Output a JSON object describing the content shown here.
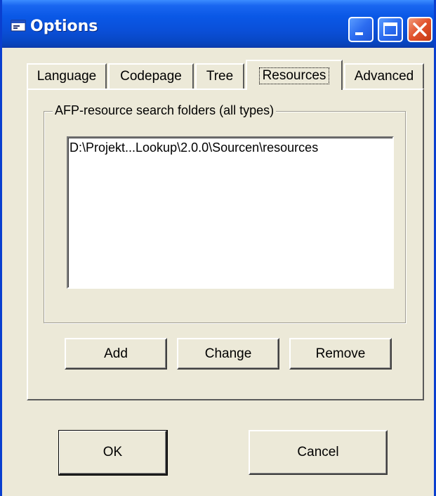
{
  "window": {
    "title": "Options"
  },
  "tabs": [
    {
      "label": "Language",
      "active": false
    },
    {
      "label": "Codepage",
      "active": false
    },
    {
      "label": "Tree",
      "active": false
    },
    {
      "label": "Resources",
      "active": true
    },
    {
      "label": "Advanced",
      "active": false
    }
  ],
  "resources": {
    "group_label": "AFP-resource search folders (all types)",
    "folders": [
      "D:\\Projekt...Lookup\\2.0.0\\Sourcen\\resources"
    ],
    "add_label": "Add",
    "change_label": "Change",
    "remove_label": "Remove"
  },
  "footer": {
    "ok_label": "OK",
    "cancel_label": "Cancel"
  },
  "colors": {
    "titlebar": "#0a4fd8",
    "dialog_bg": "#ece9d8",
    "close_button": "#e2522c"
  }
}
